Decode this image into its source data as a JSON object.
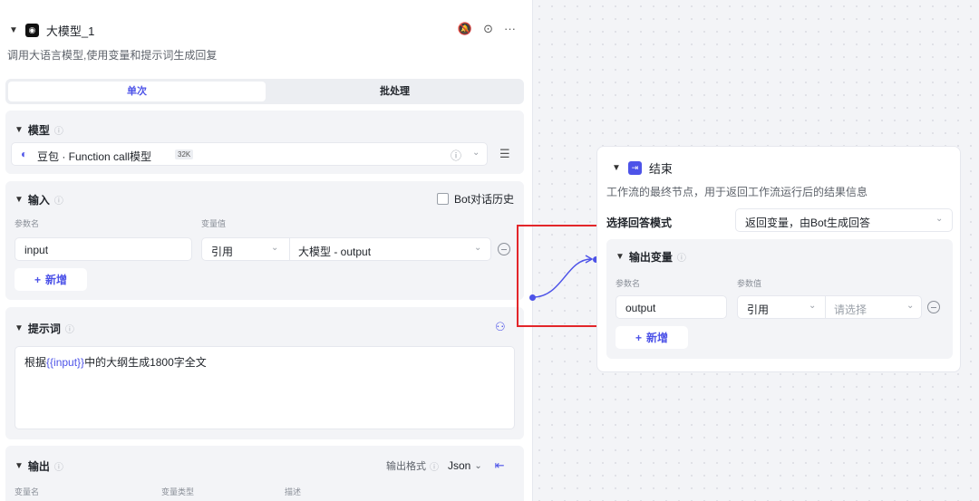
{
  "llm_node": {
    "title": "大模型_1",
    "description": "调用大语言模型,使用变量和提示词生成回复",
    "tabs": [
      "单次",
      "批处理"
    ],
    "model_section": {
      "title": "模型",
      "model_name": "豆包 · Function call模型",
      "context_badge": "32K"
    },
    "input_section": {
      "title": "输入",
      "history_checkbox_label": "Bot对话历史",
      "col_param": "参数名",
      "col_value": "变量值",
      "row": {
        "name": "input",
        "type": "引用",
        "ref": "大模型 - output"
      },
      "add_label": "新增"
    },
    "prompt_section": {
      "title": "提示词",
      "text_prefix": "根据",
      "text_var": "{{input}}",
      "text_suffix": "中的大纲生成1800字全文"
    },
    "output_section": {
      "title": "输出",
      "format_label": "输出格式",
      "format_value": "Json",
      "col_name": "变量名",
      "col_type": "变量类型",
      "col_desc": "描述"
    }
  },
  "end_node": {
    "title": "结束",
    "description": "工作流的最终节点，用于返回工作流运行后的结果信息",
    "mode_label": "选择回答模式",
    "mode_value": "返回变量，由Bot生成回答",
    "output_section": {
      "title": "输出变量",
      "col_param": "参数名",
      "col_value": "参数值",
      "row": {
        "name": "output",
        "type": "引用",
        "placeholder": "请选择"
      },
      "add_label": "新增"
    }
  },
  "colors": {
    "accent": "#4d53e8",
    "highlight": "#e3262a"
  }
}
